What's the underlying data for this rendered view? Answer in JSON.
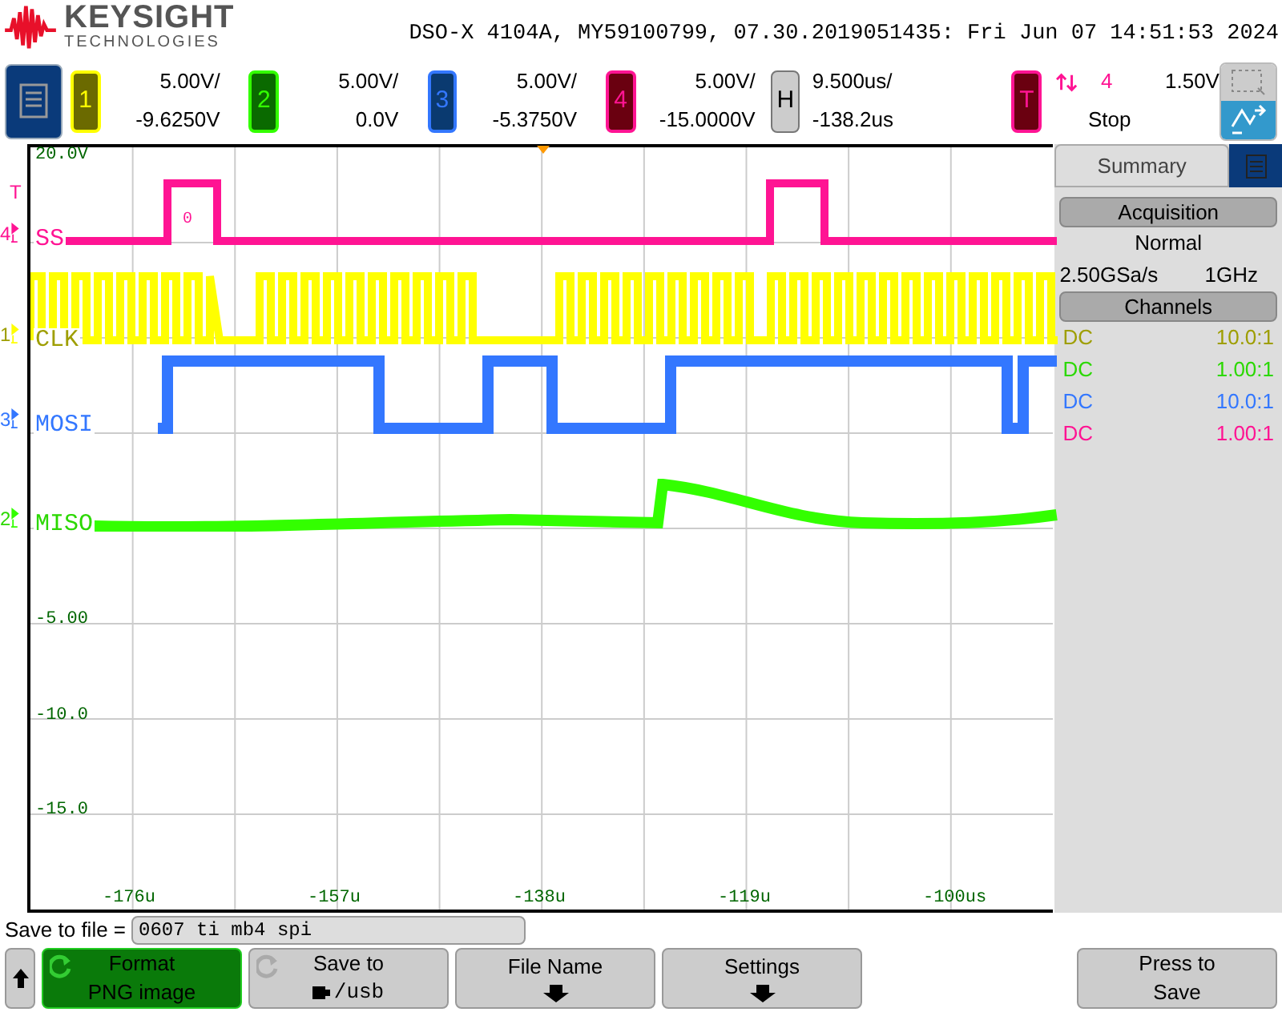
{
  "header": {
    "brand": "KEYSIGHT",
    "brand_sub": "TECHNOLOGIES",
    "title": "DSO-X 4104A, MY59100799, 07.30.2019051435: Fri Jun 07 14:51:53 2024"
  },
  "channels": [
    {
      "number": "1",
      "scale": "5.00V/",
      "offset": "-9.6250V",
      "color": "#ffff00"
    },
    {
      "number": "2",
      "scale": "5.00V/",
      "offset": "0.0V",
      "color": "#33ff00"
    },
    {
      "number": "3",
      "scale": "5.00V/",
      "offset": "-5.3750V",
      "color": "#3377ff"
    },
    {
      "number": "4",
      "scale": "5.00V/",
      "offset": "-15.0000V",
      "color": "#ff1493"
    }
  ],
  "horizontal": {
    "label": "H",
    "scale": "9.500us/",
    "position": "-138.2us"
  },
  "trigger": {
    "label": "T",
    "source": "4",
    "level": "1.50V",
    "mode": "Stop"
  },
  "plot": {
    "y_labels": [
      "20.0V",
      "-5.00",
      "-10.0",
      "-15.0"
    ],
    "x_labels": [
      "-176u",
      "-157u",
      "-138u",
      "-119u",
      "-100us"
    ],
    "trigger_marker": "T",
    "traces": [
      {
        "marker": "4",
        "label": "SS",
        "level_mark": "0",
        "color": "#ff1493"
      },
      {
        "marker": "1",
        "label": "CLK",
        "color": "#ffff00"
      },
      {
        "marker": "3",
        "label": "MOSI",
        "color": "#3377ff"
      },
      {
        "marker": "2",
        "label": "MISO",
        "color": "#33ff00"
      }
    ]
  },
  "summary": {
    "tab": "Summary",
    "acquisition_header": "Acquisition",
    "mode": "Normal",
    "sample_rate": "2.50GSa/s",
    "bandwidth": "1GHz",
    "channels_header": "Channels",
    "rows": [
      {
        "coupling": "DC",
        "probe": "10.0:1"
      },
      {
        "coupling": "DC",
        "probe": "1.00:1"
      },
      {
        "coupling": "DC",
        "probe": "10.0:1"
      },
      {
        "coupling": "DC",
        "probe": "1.00:1"
      }
    ]
  },
  "save": {
    "label": "Save to file =",
    "value": "0607 ti mb4 spi"
  },
  "softkeys": [
    {
      "kind": "back"
    },
    {
      "kind": "cycle",
      "title": "Format",
      "value": "PNG image",
      "selected": true
    },
    {
      "kind": "cycle",
      "title": "Save to",
      "value": "/usb",
      "selected": false
    },
    {
      "kind": "menu",
      "title": "File Name"
    },
    {
      "kind": "menu",
      "title": "Settings"
    },
    {
      "kind": "gap"
    },
    {
      "kind": "action",
      "title": "Press to",
      "value": "Save"
    }
  ]
}
